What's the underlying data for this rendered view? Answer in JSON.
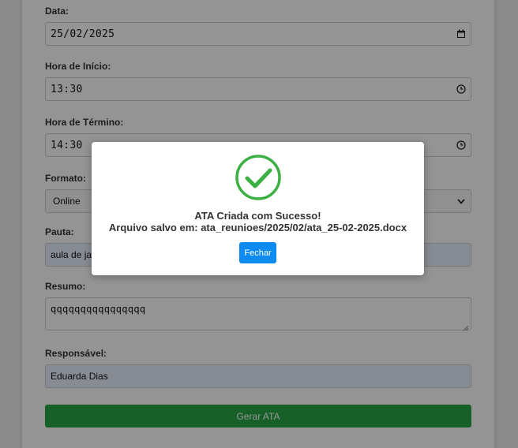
{
  "form": {
    "date": {
      "label": "Data:",
      "value": "25/02/2025"
    },
    "start_time": {
      "label": "Hora de Início:",
      "value": "13:30"
    },
    "end_time": {
      "label": "Hora de Término:",
      "value": "14:30"
    },
    "format": {
      "label": "Formato:",
      "value": "Online"
    },
    "agenda": {
      "label": "Pauta:",
      "value": "aula de ja"
    },
    "summary": {
      "label": "Resumo:",
      "value": "qqqqqqqqqqqqqqqq"
    },
    "responsible": {
      "label": "Responsável:",
      "value": "Eduarda Dias"
    },
    "submit_label": "Gerar ATA"
  },
  "modal": {
    "icon": "check-circle-icon",
    "title": "ATA Criada com Sucesso!",
    "message": "Arquivo salvo em: ata_reunioes/2025/02/ata_25-02-2025.docx",
    "close_label": "Fechar"
  },
  "colors": {
    "success": "#3cb043",
    "primary_button": "#0d8bf2",
    "submit_button": "#28a745",
    "autofill_bg": "#e8f0fe"
  }
}
